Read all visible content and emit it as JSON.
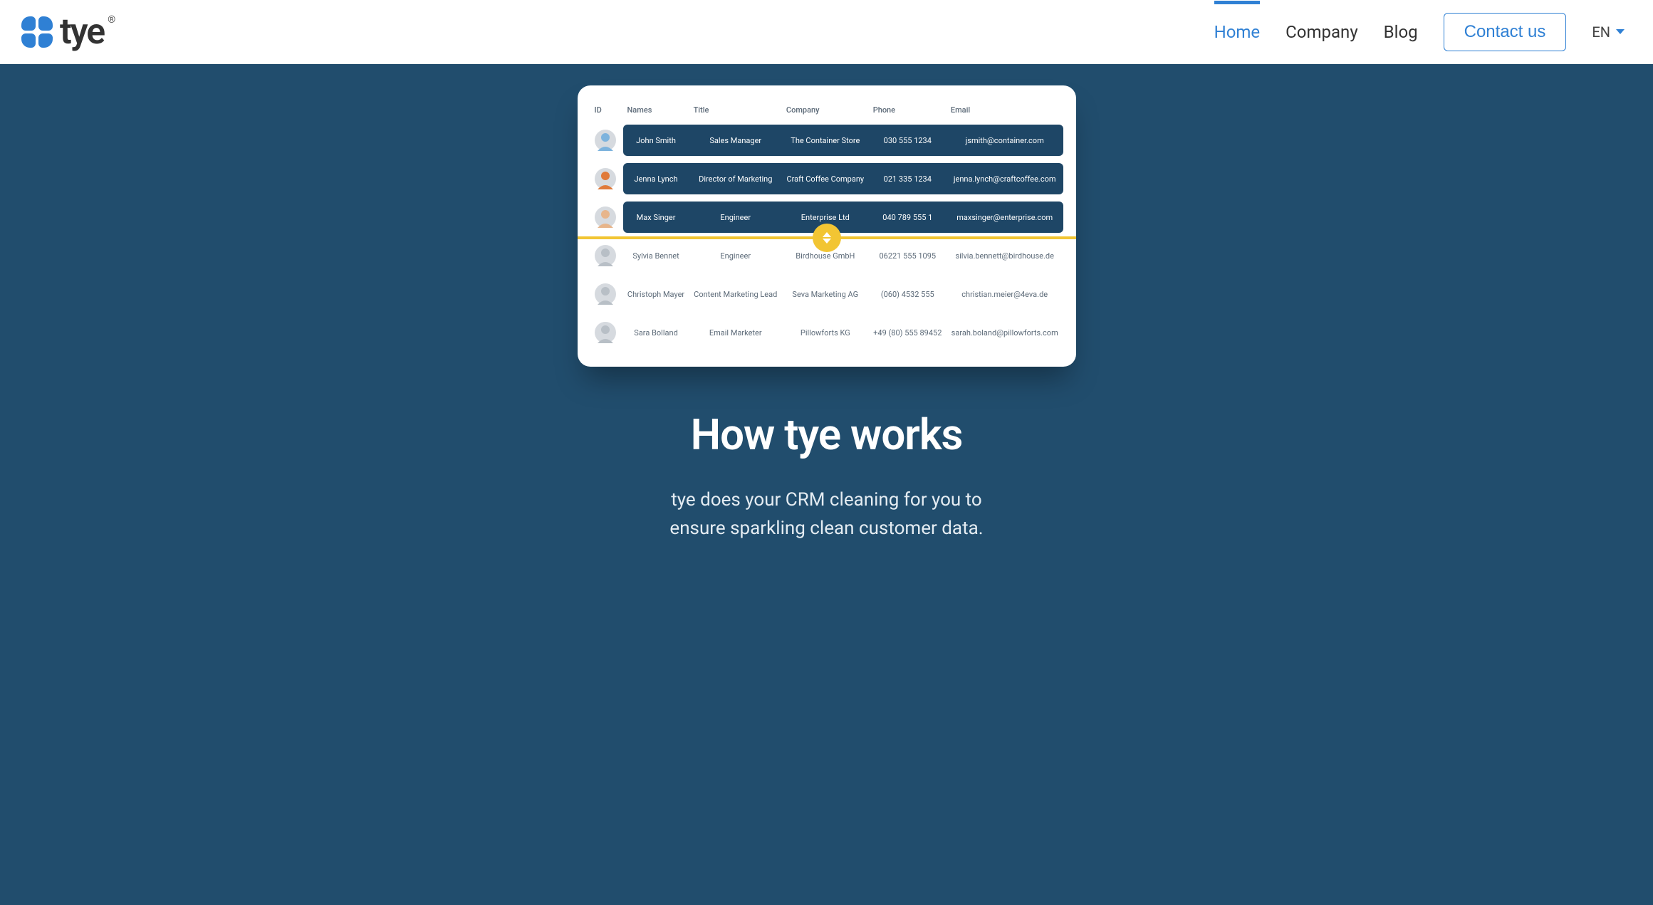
{
  "brand": {
    "name": "tye",
    "reg": "®"
  },
  "nav": {
    "home": "Home",
    "company": "Company",
    "blog": "Blog",
    "contact": "Contact us",
    "lang": "EN"
  },
  "table": {
    "headers": {
      "id": "ID",
      "names": "Names",
      "title": "Title",
      "company": "Company",
      "phone": "Phone",
      "email": "Email"
    },
    "rows": [
      {
        "style": "dark",
        "avatar": "blue",
        "name": "John Smith",
        "title": "Sales Manager",
        "company": "The Container Store",
        "phone": "030 555 1234",
        "email": "jsmith@container.com"
      },
      {
        "style": "dark",
        "avatar": "orange",
        "name": "Jenna Lynch",
        "title": "Director of Marketing",
        "company": "Craft Coffee Company",
        "phone": "021 335 1234",
        "email": "jenna.lynch@craftcoffee.com"
      },
      {
        "style": "dark",
        "avatar": "tan",
        "name": "Max Singer",
        "title": "Engineer",
        "company": "Enterprise Ltd",
        "phone": "040 789 555 1",
        "email": "maxsinger@enterprise.com"
      },
      {
        "style": "light",
        "avatar": "grey",
        "name": "Sylvia Bennet",
        "title": "Engineer",
        "company": "Birdhouse GmbH",
        "phone": "06221 555 1095",
        "email": "silvia.bennett@birdhouse.de"
      },
      {
        "style": "light",
        "avatar": "grey",
        "name": "Christoph Mayer",
        "title": "Content Marketing Lead",
        "company": "Seva Marketing AG",
        "phone": "(060) 4532 555",
        "email": "christian.meier@4eva.de"
      },
      {
        "style": "light",
        "avatar": "grey",
        "name": "Sara Bolland",
        "title": "Email Marketer",
        "company": "Pillowforts KG",
        "phone": "+49 (80) 555 89452",
        "email": "sarah.boland@pillowforts.com"
      }
    ]
  },
  "hero": {
    "title": "How tye works",
    "sub1": "tye does your CRM cleaning for you to",
    "sub2": "ensure sparkling clean customer data."
  }
}
